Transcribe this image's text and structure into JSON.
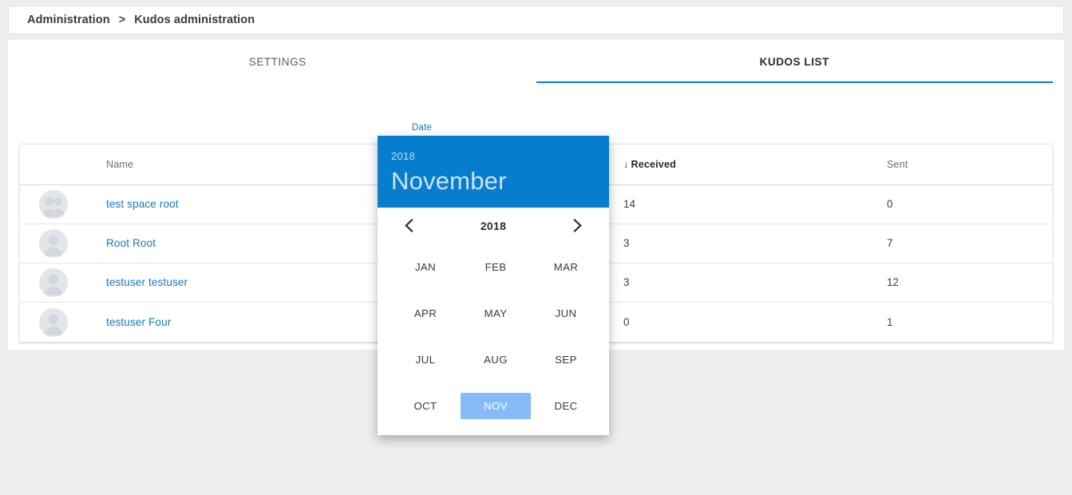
{
  "breadcrumb": {
    "items": [
      "Administration",
      "Kudos administration"
    ],
    "separator": ">"
  },
  "tabs": [
    {
      "label": "SETTINGS",
      "active": false
    },
    {
      "label": "KUDOS LIST",
      "active": true
    }
  ],
  "date_field": {
    "label": "Date",
    "value": "11/2018",
    "icon": "calendar-icon",
    "accent_color": "#0a7cd1"
  },
  "table": {
    "columns": [
      "",
      "Name",
      "Received",
      "Sent"
    ],
    "sorted_column": "Received",
    "sort_direction": "desc",
    "sort_glyph": "↓",
    "rows": [
      {
        "avatar": "group-avatar-icon",
        "name": "test space root",
        "received": "14",
        "sent": "0"
      },
      {
        "avatar": "person-avatar-icon",
        "name": "Root Root",
        "received": "3",
        "sent": "7"
      },
      {
        "avatar": "person-avatar-icon",
        "name": "testuser testuser",
        "received": "3",
        "sent": "12"
      },
      {
        "avatar": "person-avatar-icon",
        "name": "testuser Four",
        "received": "0",
        "sent": "1"
      }
    ]
  },
  "datepicker": {
    "header_year": "2018",
    "header_month": "November",
    "header_color": "#077ecd",
    "nav_year": "2018",
    "prev_glyph": "‹",
    "next_glyph": "›",
    "selected_month": "NOV",
    "selected_color": "#86bbf7",
    "months": [
      "JAN",
      "FEB",
      "MAR",
      "APR",
      "MAY",
      "JUN",
      "JUL",
      "AUG",
      "SEP",
      "OCT",
      "NOV",
      "DEC"
    ]
  }
}
